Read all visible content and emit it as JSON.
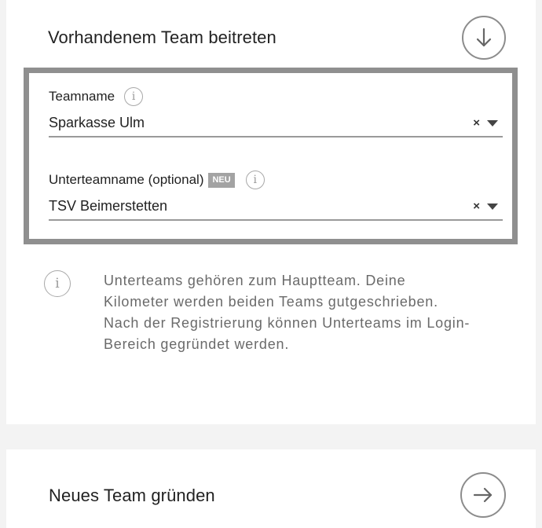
{
  "join_section": {
    "title": "Vorhandenem Team beitreten",
    "toggle_icon": "arrow-down-circle-icon"
  },
  "form": {
    "team": {
      "label": "Teamname",
      "value": "Sparkasse Ulm",
      "clear_symbol": "×"
    },
    "subteam": {
      "label": "Unterteamname (optional)",
      "badge": "NEU",
      "value": "TSV Beimerstetten",
      "clear_symbol": "×"
    },
    "info_symbol": "i"
  },
  "help": {
    "text": "Unterteams gehören zum Hauptteam. Deine Kilometer werden beiden Teams gutgeschrieben. Nach der Registrierung können Unterteams im Login-Bereich gegründet werden."
  },
  "new_section": {
    "title": "Neues Team gründen",
    "action_icon": "arrow-right-circle-icon"
  },
  "colors": {
    "border": "#8f8f8f",
    "badge": "#a3a3a3",
    "help_text": "#6a6a6a"
  }
}
